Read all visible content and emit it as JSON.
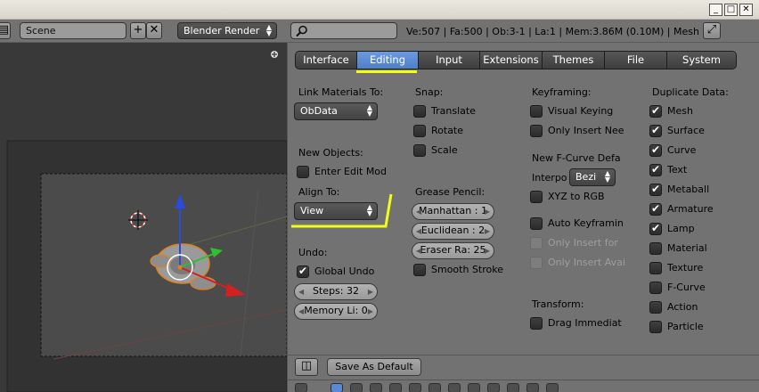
{
  "window": {
    "min_btn": "_",
    "max_btn": "□",
    "close_btn": "✕"
  },
  "header": {
    "scene": "Scene",
    "scene_add": "+",
    "scene_remove": "✕",
    "renderer": "Blender Render",
    "stats": "Ve:507 | Fa:500 | Ob:3-1 | La:1 | Mem:3.86M (0.10M) | Mesh"
  },
  "prefs": {
    "tabs": [
      {
        "label": "Interface"
      },
      {
        "label": "Editing",
        "active": true
      },
      {
        "label": "Input"
      },
      {
        "label": "Extensions"
      },
      {
        "label": "Themes"
      },
      {
        "label": "File"
      },
      {
        "label": "System"
      }
    ],
    "col1": {
      "link_materials_label": "Link Materials To:",
      "link_materials_value": "ObData",
      "new_objects_label": "New Objects:",
      "enter_edit_mode": "Enter Edit Mod",
      "align_to_label": "Align To:",
      "align_to_value": "View",
      "undo_label": "Undo:",
      "global_undo": "Global Undo",
      "steps": "Steps: 32",
      "memory_limit": "Memory Li: 0"
    },
    "col2": {
      "snap_label": "Snap:",
      "translate": "Translate",
      "rotate": "Rotate",
      "scale": "Scale",
      "grease_label": "Grease Pencil:",
      "manhattan": "Manhattan : 1",
      "euclidean": "Euclidean : 2",
      "eraser": "Eraser Ra: 25",
      "smooth_stroke": "Smooth Stroke"
    },
    "col3": {
      "keyframing_label": "Keyframing:",
      "visual_keying": "Visual Keying",
      "only_insert_needed": "Only Insert Nee",
      "new_fcurve_label": "New F-Curve Defa",
      "interp_label": "Interpo",
      "interp_value": "Bezi",
      "xyz_to_rgb": "XYZ to RGB",
      "auto_keyframing": "Auto Keyframin",
      "only_insert_for": "Only Insert for",
      "only_insert_avail": "Only Insert Avai",
      "transform_label": "Transform:",
      "drag_immediately": "Drag Immediat"
    },
    "col4": {
      "duplicate_label": "Duplicate Data:",
      "items": [
        {
          "label": "Mesh",
          "checked": true
        },
        {
          "label": "Surface",
          "checked": true
        },
        {
          "label": "Curve",
          "checked": true
        },
        {
          "label": "Text",
          "checked": true
        },
        {
          "label": "Metaball",
          "checked": true
        },
        {
          "label": "Armature",
          "checked": true
        },
        {
          "label": "Lamp",
          "checked": true
        },
        {
          "label": "Material",
          "checked": false
        },
        {
          "label": "Texture",
          "checked": false
        },
        {
          "label": "F-Curve",
          "checked": false
        },
        {
          "label": "Action",
          "checked": false
        },
        {
          "label": "Particle",
          "checked": false
        }
      ]
    },
    "footer": {
      "save_default": "Save As Default"
    }
  },
  "colors": {
    "annotation": "#f2ff14",
    "active_tab": "#5a88d4"
  }
}
